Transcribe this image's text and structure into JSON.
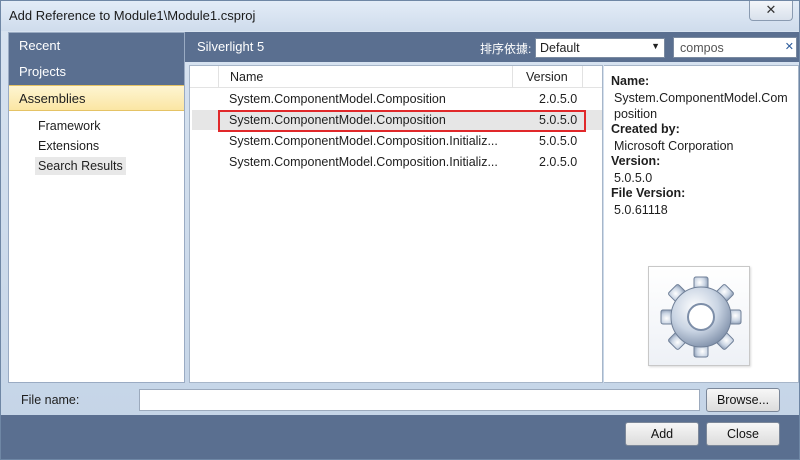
{
  "window": {
    "title": "Add Reference to Module1\\Module1.csproj",
    "close_label": "✕"
  },
  "nav": {
    "headers": [
      {
        "label": "Recent"
      },
      {
        "label": "Projects"
      },
      {
        "label": "Assemblies"
      }
    ],
    "sub_items": [
      {
        "label": "Framework"
      },
      {
        "label": "Extensions"
      },
      {
        "label": "Search Results"
      }
    ]
  },
  "topbar": {
    "framework": "Silverlight 5",
    "sort_label": "排序依據:",
    "sort_value": "Default",
    "search_value": "compos",
    "search_clear": "✕"
  },
  "list": {
    "columns": {
      "name": "Name",
      "version": "Version"
    },
    "rows": [
      {
        "name": "System.ComponentModel.Composition",
        "version": "2.0.5.0"
      },
      {
        "name": "System.ComponentModel.Composition",
        "version": "5.0.5.0"
      },
      {
        "name": "System.ComponentModel.Composition.Initializ...",
        "version": "5.0.5.0"
      },
      {
        "name": "System.ComponentModel.Composition.Initializ...",
        "version": "2.0.5.0"
      }
    ]
  },
  "details": {
    "name_label": "Name:",
    "name_value": "System.ComponentModel.Composition",
    "created_label": "Created by:",
    "created_value": "Microsoft Corporation",
    "version_label": "Version:",
    "version_value": "5.0.5.0",
    "file_version_label": "File Version:",
    "file_version_value": "5.0.61118",
    "icon": "gear-icon"
  },
  "bottom": {
    "file_name_label": "File name:",
    "file_name_value": "",
    "browse_label": "Browse...",
    "add_label": "Add",
    "close_label": "Close"
  },
  "colors": {
    "nav_header": "#5a6f90",
    "selected_header": "#fbe6a3",
    "highlight_border": "#e0282a"
  }
}
